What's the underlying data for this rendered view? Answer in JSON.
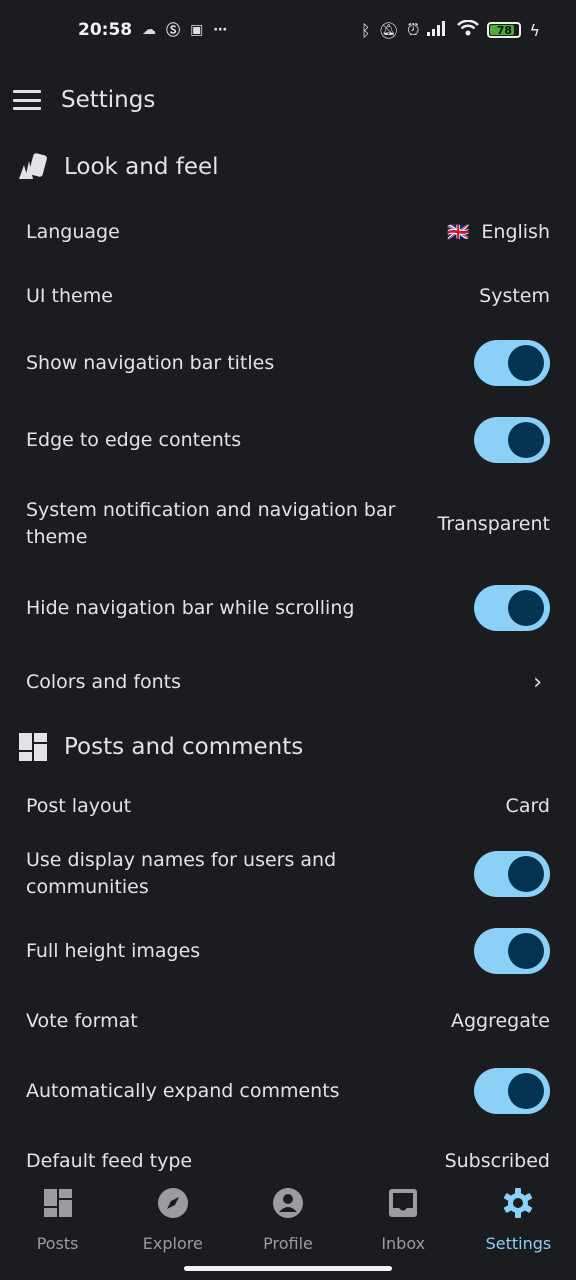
{
  "status_bar": {
    "time": "20:58",
    "battery": "78",
    "more_icon": "⋯"
  },
  "app_bar": {
    "title": "Settings"
  },
  "sections": {
    "look": {
      "title": "Look and feel",
      "language_label": "Language",
      "language_value": "English",
      "language_flag": "🇬🇧",
      "theme_label": "UI theme",
      "theme_value": "System",
      "nav_titles_label": "Show navigation bar titles",
      "nav_titles_on": true,
      "edge_label": "Edge to edge contents",
      "edge_on": true,
      "sysbar_label": "System notification and navigation bar theme",
      "sysbar_value": "Transparent",
      "hide_nav_label": "Hide navigation bar while scrolling",
      "hide_nav_on": true,
      "colors_label": "Colors and fonts",
      "colors_chevron": "›"
    },
    "posts": {
      "title": "Posts and comments",
      "layout_label": "Post layout",
      "layout_value": "Card",
      "display_names_label": "Use display names for users and communities",
      "display_names_on": true,
      "full_height_label": "Full height images",
      "full_height_on": true,
      "vote_label": "Vote format",
      "vote_value": "Aggregate",
      "expand_label": "Automatically expand comments",
      "expand_on": true,
      "feed_label": "Default feed type",
      "feed_value": "Subscribed"
    }
  },
  "bottom_nav": {
    "items": [
      {
        "label": "Posts",
        "icon": "dashboard-icon"
      },
      {
        "label": "Explore",
        "icon": "compass-icon"
      },
      {
        "label": "Profile",
        "icon": "account-icon"
      },
      {
        "label": "Inbox",
        "icon": "inbox-icon"
      },
      {
        "label": "Settings",
        "icon": "gear-icon",
        "active": true
      }
    ]
  },
  "colors": {
    "accent": "#8bd0f7",
    "knob": "#023350",
    "background": "#1a1c1f"
  }
}
